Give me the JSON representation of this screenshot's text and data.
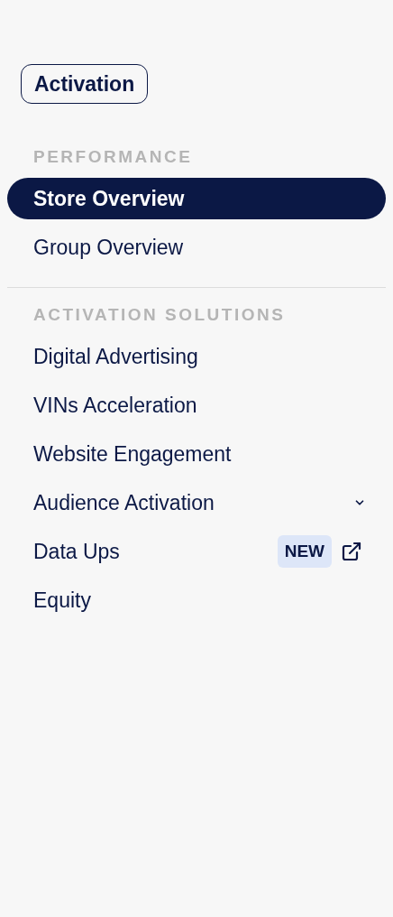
{
  "badge": {
    "label": "Activation"
  },
  "sections": [
    {
      "heading": "PERFORMANCE",
      "items": [
        {
          "label": "Store Overview",
          "kind": "link",
          "selected": true
        },
        {
          "label": "Group Overview",
          "kind": "link",
          "selected": false
        }
      ]
    },
    {
      "heading": "ACTIVATION SOLUTIONS",
      "items": [
        {
          "label": "Digital Advertising",
          "kind": "link",
          "selected": false
        },
        {
          "label": "VINs Acceleration",
          "kind": "link",
          "selected": false
        },
        {
          "label": "Website Engagement",
          "kind": "link",
          "selected": false
        },
        {
          "label": "Audience Activation",
          "kind": "expandable",
          "selected": false,
          "expanded": false
        },
        {
          "label": "Data Ups",
          "kind": "external",
          "selected": false,
          "tag": "NEW"
        },
        {
          "label": "Equity",
          "kind": "link",
          "selected": false
        }
      ]
    }
  ]
}
